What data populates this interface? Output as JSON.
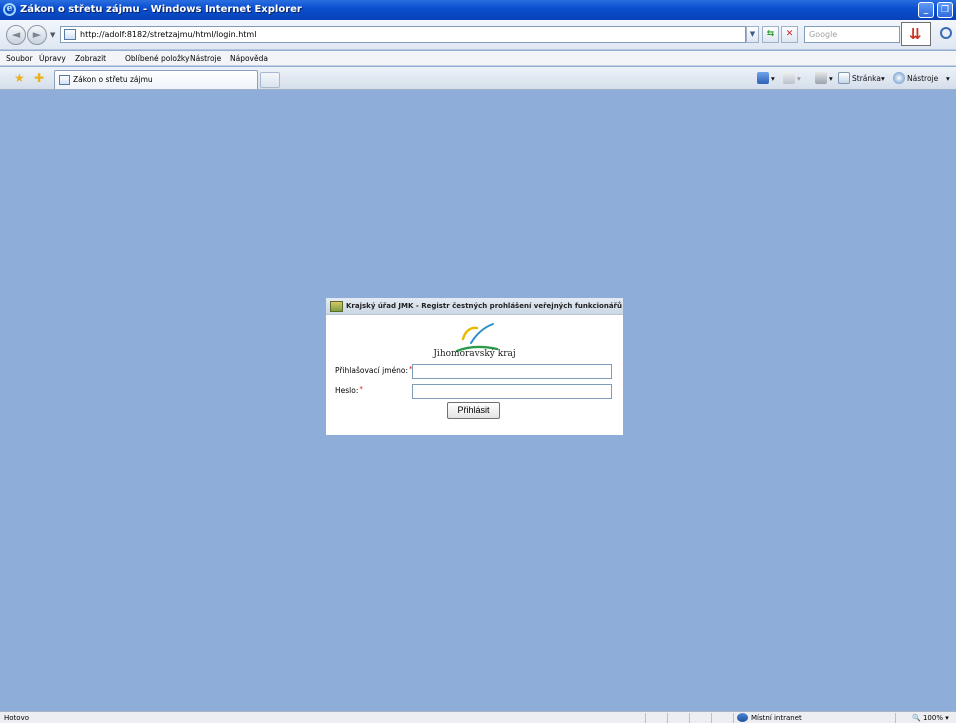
{
  "window": {
    "title": "Zákon o střetu zájmu - Windows Internet Explorer",
    "minimize_glyph": "_",
    "restore_glyph": "❐"
  },
  "addressbar": {
    "url": "http://adolf:8182/stretzajmu/html/login.html",
    "search_placeholder": "Google"
  },
  "menu": {
    "items": [
      "Soubor",
      "Úpravy",
      "Zobrazit",
      "Oblíbené položky",
      "Nástroje",
      "Nápověda"
    ]
  },
  "tabs": {
    "active_tab": "Zákon o střetu zájmu"
  },
  "commandbar": {
    "page_label": "Stránka",
    "tools_label": "Nástroje",
    "dropdown_glyph": "▾"
  },
  "login": {
    "header": "Krajský úřad JMK - Registr čestných prohlášení veřejných funkcionářů",
    "logo_text": "Jihomoravský kraj",
    "username_label": "Přihlašovací jméno:",
    "username_value": "",
    "password_label": "Heslo:",
    "password_value": "",
    "required_mark": "*",
    "submit_label": "Přihlásit"
  },
  "status": {
    "text": "Hotovo",
    "zone": "Místní intranet",
    "zoom": "100%"
  },
  "colors": {
    "page_background": "#8eadd9",
    "titlebar": "#0a4fd0",
    "required": "#e00000"
  }
}
